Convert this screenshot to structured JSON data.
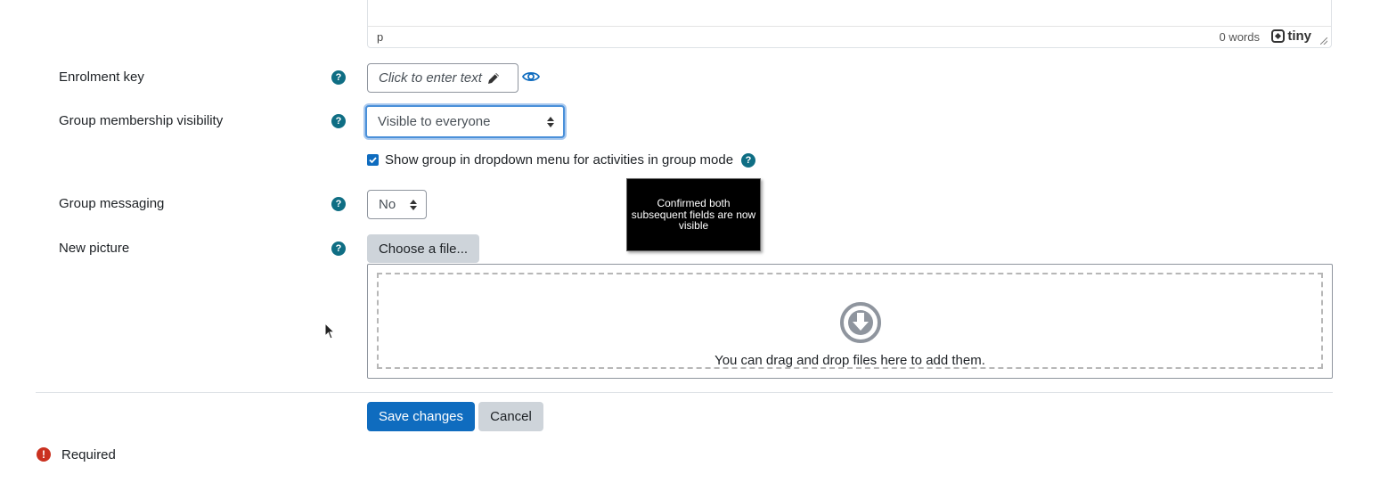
{
  "editor": {
    "path": "p",
    "word_count": "0 words",
    "brand": "tiny"
  },
  "enrolment_key": {
    "label": "Enrolment key",
    "value": "Click to enter text"
  },
  "visibility": {
    "label": "Group membership visibility",
    "selected": "Visible to everyone"
  },
  "dropdown_checkbox": {
    "label": "Show group in dropdown menu for activities in group mode",
    "checked": true
  },
  "messaging": {
    "label": "Group messaging",
    "selected": "No"
  },
  "tooltip": {
    "text": "Confirmed both subsequent fields are now visible"
  },
  "picture": {
    "label": "New picture",
    "choose_label": "Choose a file...",
    "drop_text": "You can drag and drop files here to add them."
  },
  "actions": {
    "save_label": "Save changes",
    "cancel_label": "Cancel"
  },
  "footer": {
    "required_label": "Required"
  },
  "colors": {
    "primary": "#0f6cbf",
    "help_icon": "#0f6e84",
    "required_icon": "#ca3120",
    "secondary_button": "#ced4da"
  },
  "icons": {
    "help": "help-circle-icon",
    "edit": "pencil-icon",
    "reveal": "eye-icon",
    "drop": "arrow-down-circle-icon",
    "required": "exclamation-circle-icon"
  }
}
